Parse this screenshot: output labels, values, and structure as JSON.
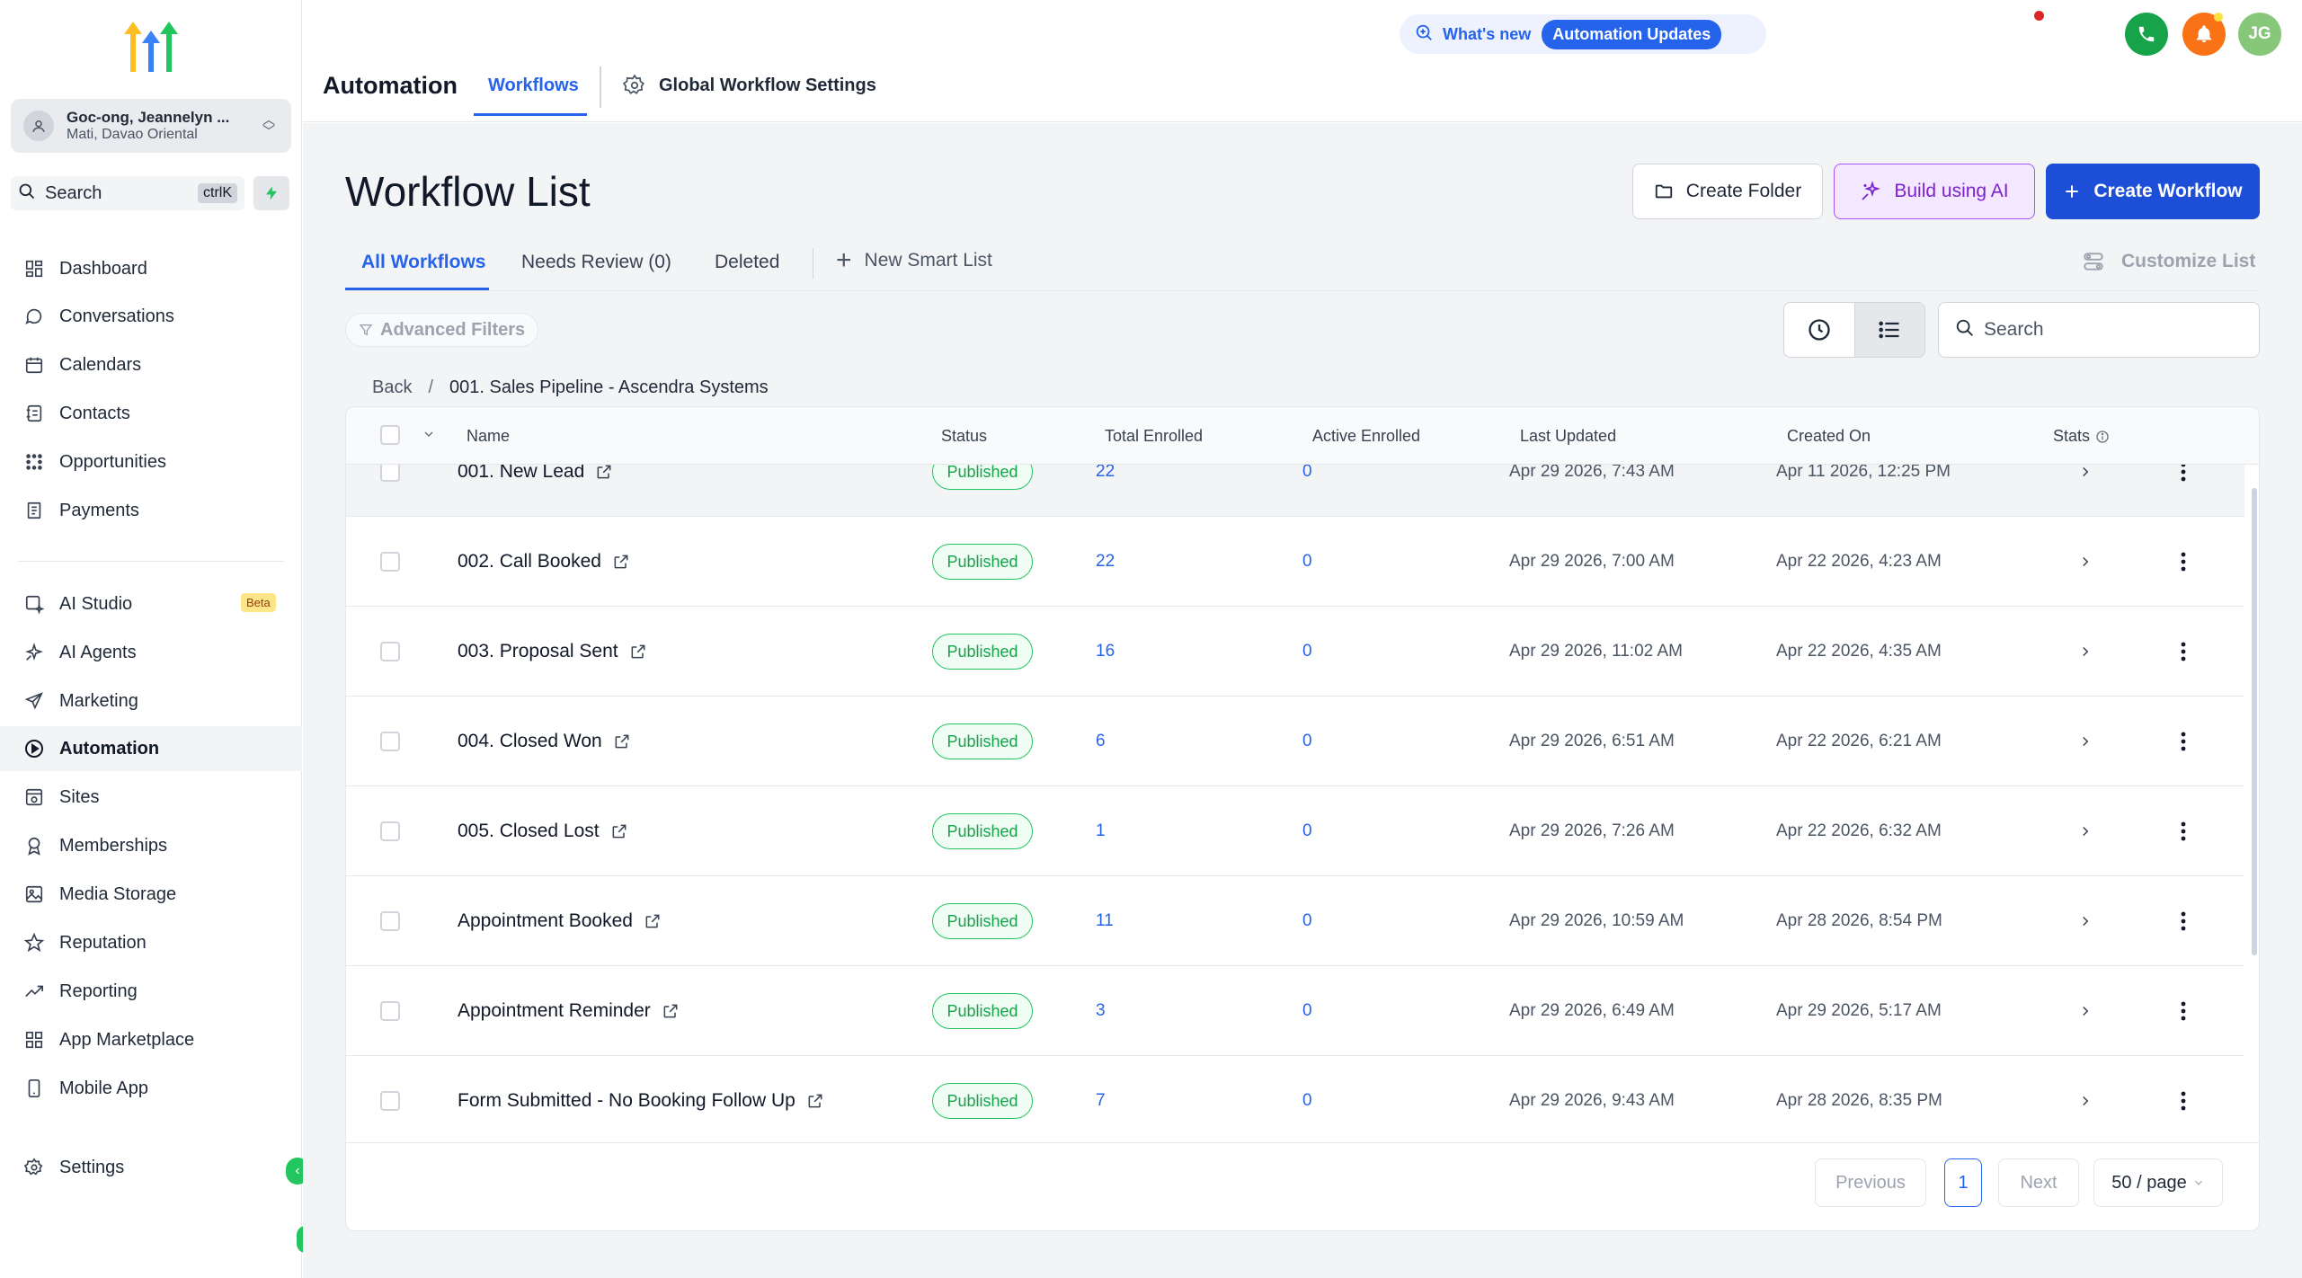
{
  "app": {
    "account_name": "Goc-ong, Jeannelyn ...",
    "account_location": "Mati, Davao Oriental",
    "search_label": "Search",
    "search_shortcut": "ctrlK"
  },
  "sidebar": {
    "items": [
      {
        "label": "Dashboard",
        "icon": "dashboard-icon"
      },
      {
        "label": "Conversations",
        "icon": "chat-icon"
      },
      {
        "label": "Calendars",
        "icon": "calendar-icon"
      },
      {
        "label": "Contacts",
        "icon": "contacts-icon"
      },
      {
        "label": "Opportunities",
        "icon": "opportunities-icon"
      },
      {
        "label": "Payments",
        "icon": "payments-icon"
      },
      {
        "label": "AI Studio",
        "icon": "ai-studio-icon",
        "badge": "Beta"
      },
      {
        "label": "AI Agents",
        "icon": "sparkle-icon"
      },
      {
        "label": "Marketing",
        "icon": "send-icon"
      },
      {
        "label": "Automation",
        "icon": "automation-icon",
        "active": true
      },
      {
        "label": "Sites",
        "icon": "sites-icon"
      },
      {
        "label": "Memberships",
        "icon": "membership-icon"
      },
      {
        "label": "Media Storage",
        "icon": "image-icon"
      },
      {
        "label": "Reputation",
        "icon": "star-icon"
      },
      {
        "label": "Reporting",
        "icon": "trend-icon"
      },
      {
        "label": "App Marketplace",
        "icon": "grid-icon"
      },
      {
        "label": "Mobile App",
        "icon": "mobile-icon"
      }
    ],
    "settings_label": "Settings"
  },
  "header": {
    "title": "Automation",
    "tabs": [
      "Workflows",
      "Global Workflow Settings"
    ],
    "whats_new": "What's new",
    "updates_label": "Automation Updates",
    "user_initials": "JG"
  },
  "page": {
    "title": "Workflow List",
    "create_folder": "Create Folder",
    "build_ai": "Build using AI",
    "create_workflow": "Create Workflow",
    "subtabs": [
      "All Workflows",
      "Needs Review (0)",
      "Deleted"
    ],
    "new_smart_list": "New Smart List",
    "customize_list": "Customize List",
    "advanced_filters": "Advanced Filters",
    "search_placeholder": "Search",
    "breadcrumb_back": "Back",
    "breadcrumb_sep": "/",
    "breadcrumb_current": "001. Sales Pipeline - Ascendra Systems"
  },
  "table": {
    "columns": [
      "Name",
      "Status",
      "Total Enrolled",
      "Active Enrolled",
      "Last Updated",
      "Created On",
      "Stats"
    ],
    "rows": [
      {
        "name": "001. New Lead",
        "status": "Published",
        "total": "22",
        "active": "0",
        "updated": "Apr 29 2026, 7:43 AM",
        "created": "Apr 11 2026, 12:25 PM"
      },
      {
        "name": "002. Call Booked",
        "status": "Published",
        "total": "22",
        "active": "0",
        "updated": "Apr 29 2026, 7:00 AM",
        "created": "Apr 22 2026, 4:23 AM"
      },
      {
        "name": "003. Proposal Sent",
        "status": "Published",
        "total": "16",
        "active": "0",
        "updated": "Apr 29 2026, 11:02 AM",
        "created": "Apr 22 2026, 4:35 AM"
      },
      {
        "name": "004. Closed Won",
        "status": "Published",
        "total": "6",
        "active": "0",
        "updated": "Apr 29 2026, 6:51 AM",
        "created": "Apr 22 2026, 6:21 AM"
      },
      {
        "name": "005. Closed Lost",
        "status": "Published",
        "total": "1",
        "active": "0",
        "updated": "Apr 29 2026, 7:26 AM",
        "created": "Apr 22 2026, 6:32 AM"
      },
      {
        "name": "Appointment Booked",
        "status": "Published",
        "total": "11",
        "active": "0",
        "updated": "Apr 29 2026, 10:59 AM",
        "created": "Apr 28 2026, 8:54 PM"
      },
      {
        "name": "Appointment Reminder",
        "status": "Published",
        "total": "3",
        "active": "0",
        "updated": "Apr 29 2026, 6:49 AM",
        "created": "Apr 29 2026, 5:17 AM"
      },
      {
        "name": "Form Submitted - No Booking Follow Up",
        "status": "Published",
        "total": "7",
        "active": "0",
        "updated": "Apr 29 2026, 9:43 AM",
        "created": "Apr 28 2026, 8:35 PM"
      }
    ]
  },
  "pagination": {
    "previous": "Previous",
    "current_page": "1",
    "next": "Next",
    "page_size": "50 / page"
  },
  "colors": {
    "accent": "#2563eb",
    "success": "#16a34a",
    "ai_purple": "#7e22ce",
    "phone_green": "#16a34a",
    "bell_orange": "#f97316",
    "avatar_green": "#86c77a"
  }
}
